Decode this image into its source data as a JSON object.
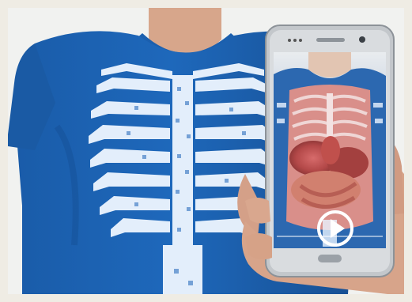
{
  "image": {
    "kind": "photo",
    "subject": "augmented-reality-anatomy-tshirt",
    "colors": {
      "frame": "#efece4",
      "backdrop": "#f1f2f0",
      "shirt": "#1d64b8",
      "shirt_shadow": "#154f95",
      "print": "#e9f3ff",
      "skin": "#d6a68a",
      "phone": "#bfc3c7",
      "phone_dark": "#6f757b",
      "organs": "#b84a4a",
      "play_button": "#ffffff"
    }
  },
  "overlay": {
    "play_icon": "play-icon"
  }
}
